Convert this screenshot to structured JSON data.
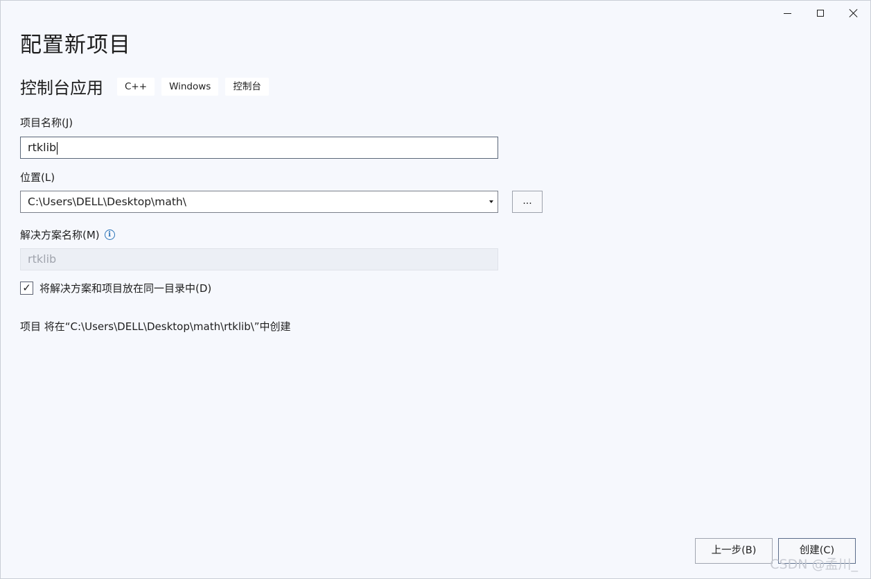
{
  "page_title": "配置新项目",
  "template": {
    "name": "控制台应用",
    "tags": [
      "C++",
      "Windows",
      "控制台"
    ]
  },
  "project_name": {
    "label": "项目名称(J)",
    "value": "rtklib"
  },
  "location": {
    "label": "位置(L)",
    "value": "C:\\Users\\DELL\\Desktop\\math\\",
    "browse_label": "..."
  },
  "solution_name": {
    "label": "解决方案名称(M)",
    "value": "rtklib",
    "info_icon": "info-icon",
    "info_glyph": "i"
  },
  "same_dir_checkbox": {
    "label": "将解决方案和项目放在同一目录中(D)",
    "checked": true,
    "check_glyph": "✓"
  },
  "summary": "项目 将在“C:\\Users\\DELL\\Desktop\\math\\rtklib\\”中创建",
  "buttons": {
    "back": "上一步(B)",
    "create": "创建(C)"
  },
  "watermark": "CSDN @孟川_",
  "icons": {
    "minimize": "minimize-icon",
    "maximize": "maximize-icon",
    "close": "close-icon",
    "dropdown": "chevron-down-icon",
    "checkmark": "checkmark-icon"
  }
}
